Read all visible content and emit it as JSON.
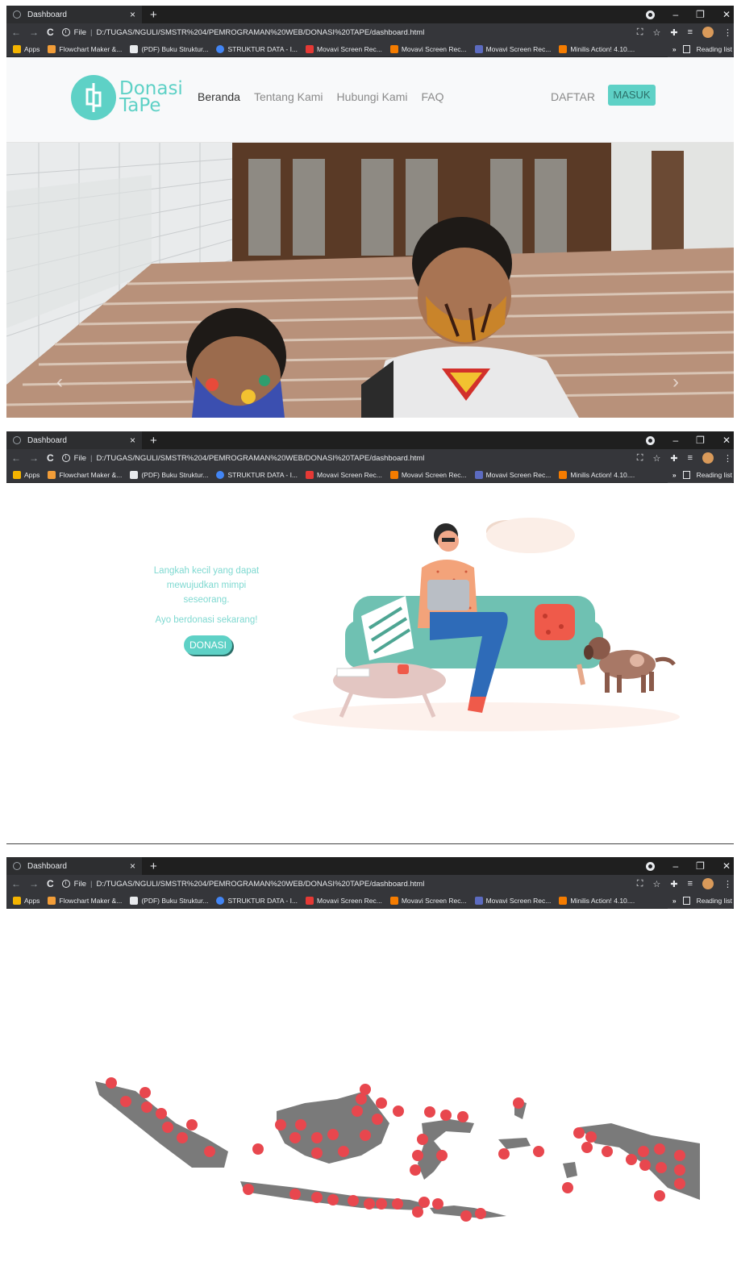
{
  "browser": {
    "tab_title": "Dashboard",
    "tab_close": "×",
    "new_tab": "+",
    "url_label": "File",
    "url": "D:/TUGAS/NGULI/SMSTR%204/PEMROGRAMAN%20WEB/DONASI%20TAPE/dashboard.html",
    "bookmarks": [
      {
        "label": "Apps",
        "color": "#f4b400"
      },
      {
        "label": "Flowchart Maker &...",
        "color": "#f29d38"
      },
      {
        "label": "(PDF) Buku Struktur...",
        "color": "#e8eaed"
      },
      {
        "label": "STRUKTUR DATA - I...",
        "color": "#4285f4"
      },
      {
        "label": "Movavi Screen Rec...",
        "color": "#e53935"
      },
      {
        "label": "Movavi Screen Rec...",
        "color": "#f57c00"
      },
      {
        "label": "Movavi Screen Rec...",
        "color": "#5c6bc0"
      },
      {
        "label": "Minilis Action! 4.10....",
        "color": "#f57c00"
      }
    ],
    "bookmarks_more": "»",
    "reading_list": "Reading list"
  },
  "site": {
    "logo_line1": "Donasi",
    "logo_line2": "TaPe",
    "menu": [
      "Beranda",
      "Tentang Kami",
      "Hubungi Kami",
      "FAQ"
    ],
    "daftar": "DAFTAR",
    "masuk": "MASUK",
    "hero_prev": "‹",
    "hero_next": "›"
  },
  "cta": {
    "tagline": "Langkah kecil yang dapat mewujudkan mimpi seseorang.",
    "call": "Ayo berdonasi sekarang!",
    "button": "DONASI"
  },
  "colors": {
    "brand": "#5ed1c6",
    "brand_dark": "#2b6e68",
    "map_land": "#7a7a7a",
    "map_pin": "#e8474e"
  }
}
